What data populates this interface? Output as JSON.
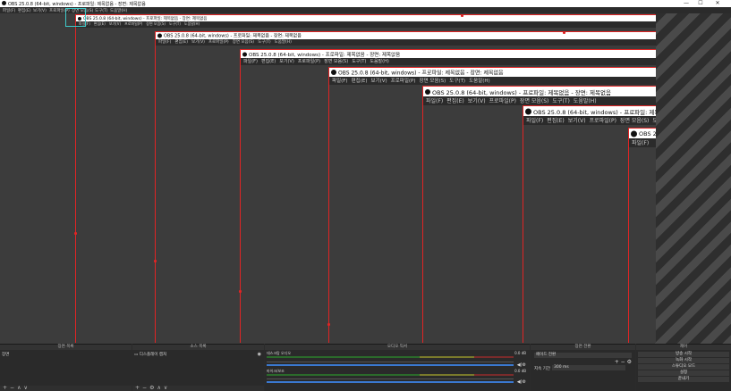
{
  "window": {
    "title": "OBS 25.0.8 (64-bit, windows) - 프로파일: 제목없음 - 장면: 제목없음",
    "minimize": "—",
    "maximize": "☐",
    "close": "✕"
  },
  "menu": [
    "파일(F)",
    "편집(E)",
    "보기(V)",
    "프로파일(P)",
    "장면 모음(S)",
    "도구(T)",
    "도움말(H)"
  ],
  "nested_title": "OBS 25.0.8 (64-bit, windows) - 프로파일: 제목없음 - 장면: 제목없음",
  "nested_title_short": "OBS 25",
  "docks": {
    "scenes": {
      "title": "장면 목록",
      "item": "장면"
    },
    "sources": {
      "title": "소스 목록",
      "item": "디스플레이 캡처"
    },
    "mixer": {
      "title": "오디오 믹서",
      "channels": [
        {
          "name": "데스크탑 오디오",
          "db": "0.0 dB"
        },
        {
          "name": "마이크/보조",
          "db": "0.0 dB"
        }
      ]
    },
    "transitions": {
      "title": "장면 전환",
      "type": "페이드 전환",
      "duration_label": "지속 기간",
      "duration_value": "300 ms"
    },
    "controls": {
      "title": "제어",
      "buttons": [
        "방송 시작",
        "녹화 시작",
        "스튜디오 모드",
        "설정",
        "끝내기"
      ]
    }
  },
  "icons": {
    "obs_logo": "obs-logo-icon",
    "add": "+",
    "remove": "−",
    "settings": "⚙",
    "up": "∧",
    "down": "∨",
    "speaker": "🔊"
  },
  "colors": {
    "accent_red": "#e02424",
    "selection": "#3fc9c9"
  }
}
